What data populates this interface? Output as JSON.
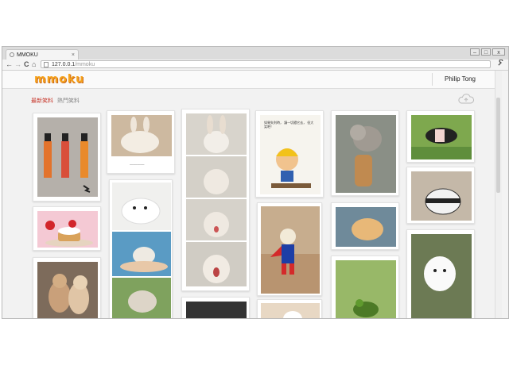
{
  "browser": {
    "tab_title": "MMOKU",
    "tab_close": "×",
    "url_host": "127.0.0.1",
    "url_path": "/mmoku",
    "back": "←",
    "forward": "→",
    "reload": "C",
    "home": "⌂",
    "wrench": "🔧",
    "min": "–",
    "max": "□",
    "close": "x"
  },
  "site": {
    "logo": "mmoku",
    "user": "Philip Tong",
    "tabs": [
      {
        "label": "最新笑料",
        "active": true
      },
      {
        "label": "熱門笑料",
        "active": false
      }
    ]
  },
  "cards": [
    {
      "alt": "three geishas in kimonos",
      "caption": ""
    },
    {
      "alt": "white fluffy rabbit",
      "caption": "▁▁▁▁▁▁▁▁"
    },
    {
      "alt": "rabbit photo sequence",
      "caption": ""
    },
    {
      "alt": "cartoon boy with helmet",
      "caption": "如果失利時， 讓一切隨它去， 但大笑吧！"
    },
    {
      "alt": "cat hugging bottle",
      "caption": ""
    },
    {
      "alt": "pig on grass",
      "caption": ""
    },
    {
      "alt": "strawberry cake",
      "caption": ""
    },
    {
      "alt": "baby seal photos",
      "caption": ""
    },
    {
      "alt": "dog in superhero costume",
      "caption": ""
    },
    {
      "alt": "puppy sleeping",
      "caption": ""
    },
    {
      "alt": "toy car",
      "caption": ""
    },
    {
      "alt": "two cats fighting",
      "caption": ""
    },
    {
      "alt": "fluffy white animal",
      "caption": ""
    },
    {
      "alt": "frog on leaf",
      "caption": ""
    },
    {
      "alt": "cartoon card",
      "caption": ""
    },
    {
      "alt": "photo card",
      "caption": ""
    }
  ],
  "colors": {
    "logo": "#f5a21d",
    "active_tab": "#c83a2e",
    "inactive_tab": "#888888"
  }
}
